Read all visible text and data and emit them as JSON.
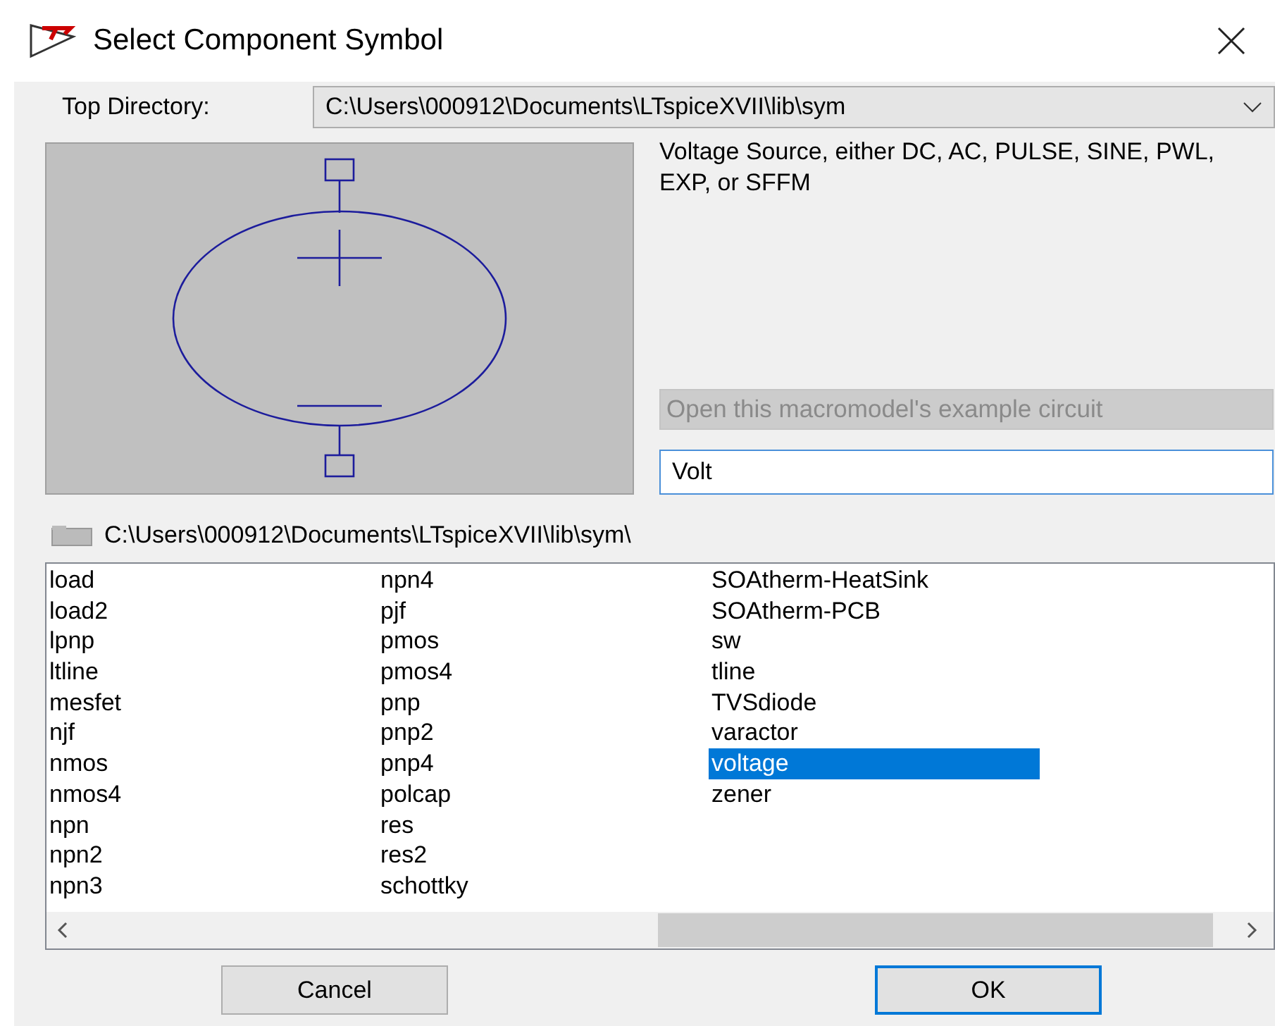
{
  "window": {
    "title": "Select Component Symbol"
  },
  "top_directory": {
    "label": "Top Directory:",
    "value": "C:\\Users\\000912\\Documents\\LTspiceXVII\\lib\\sym"
  },
  "description": "Voltage Source, either DC, AC, PULSE, SINE, PWL, EXP, or SFFM",
  "example_button": {
    "label": "Open this macromodel's example circuit",
    "disabled": true
  },
  "search": {
    "value": "Volt"
  },
  "current_path": "C:\\Users\\000912\\Documents\\LTspiceXVII\\lib\\sym\\",
  "columns": [
    [
      {
        "name": "load",
        "selected": false
      },
      {
        "name": "load2",
        "selected": false
      },
      {
        "name": "lpnp",
        "selected": false
      },
      {
        "name": "ltline",
        "selected": false
      },
      {
        "name": "mesfet",
        "selected": false
      },
      {
        "name": "njf",
        "selected": false
      },
      {
        "name": "nmos",
        "selected": false
      },
      {
        "name": "nmos4",
        "selected": false
      },
      {
        "name": "npn",
        "selected": false
      },
      {
        "name": "npn2",
        "selected": false
      },
      {
        "name": "npn3",
        "selected": false
      }
    ],
    [
      {
        "name": "npn4",
        "selected": false
      },
      {
        "name": "pjf",
        "selected": false
      },
      {
        "name": "pmos",
        "selected": false
      },
      {
        "name": "pmos4",
        "selected": false
      },
      {
        "name": "pnp",
        "selected": false
      },
      {
        "name": "pnp2",
        "selected": false
      },
      {
        "name": "pnp4",
        "selected": false
      },
      {
        "name": "polcap",
        "selected": false
      },
      {
        "name": "res",
        "selected": false
      },
      {
        "name": "res2",
        "selected": false
      },
      {
        "name": "schottky",
        "selected": false
      }
    ],
    [
      {
        "name": "SOAtherm-HeatSink",
        "selected": false
      },
      {
        "name": "SOAtherm-PCB",
        "selected": false
      },
      {
        "name": "sw",
        "selected": false
      },
      {
        "name": "tline",
        "selected": false
      },
      {
        "name": "TVSdiode",
        "selected": false
      },
      {
        "name": "varactor",
        "selected": false
      },
      {
        "name": "voltage",
        "selected": true
      },
      {
        "name": "zener",
        "selected": false
      }
    ]
  ],
  "buttons": [
    {
      "label": "Cancel",
      "default": false
    },
    {
      "label": "OK",
      "default": true
    }
  ]
}
